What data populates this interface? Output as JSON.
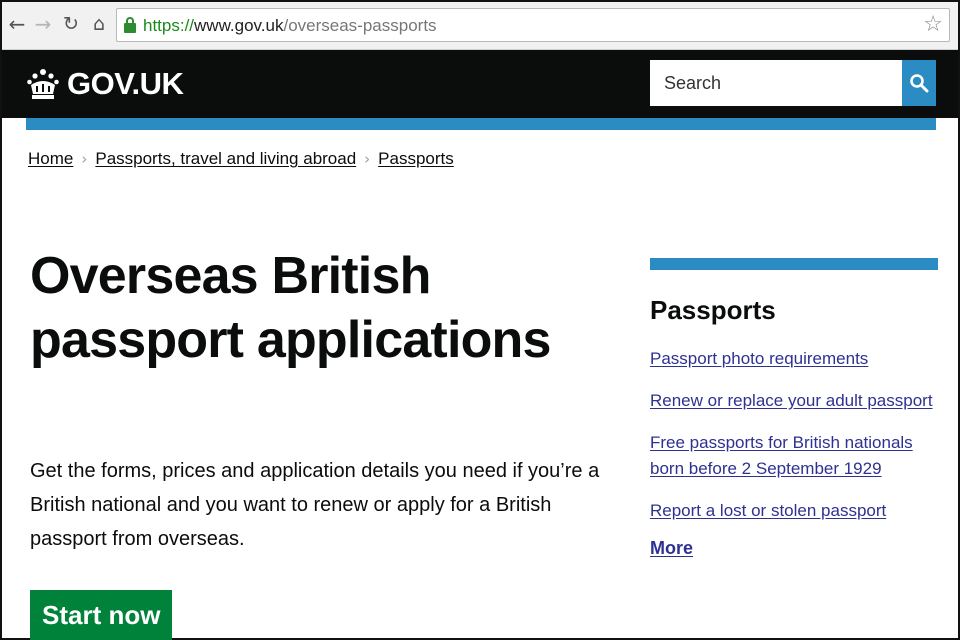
{
  "browser": {
    "url_scheme": "https://",
    "url_host": "www.gov.uk",
    "url_path": "/overseas-passports"
  },
  "header": {
    "logo_text": "GOV.UK",
    "search_placeholder": "Search"
  },
  "breadcrumb": [
    {
      "label": "Home"
    },
    {
      "label": "Passports, travel and living abroad"
    },
    {
      "label": "Passports"
    }
  ],
  "main": {
    "title": "Overseas British passport applications",
    "lead": "Get the forms, prices and application details you need if you’re a British national and you want to renew or apply for a British passport from overseas.",
    "start_label": "Start now"
  },
  "related": {
    "title": "Passports",
    "links": [
      {
        "label": "Passport photo requirements"
      },
      {
        "label": "Renew or replace your adult passport"
      },
      {
        "label": "Free passports for British nationals born before 2 September 1929"
      },
      {
        "label": "Report a lost or stolen passport"
      }
    ],
    "more_label": "More"
  },
  "colors": {
    "header_bg": "#0b0c0c",
    "accent_blue": "#2b8cc4",
    "start_green": "#00823b",
    "link": "#2e3191"
  },
  "icons": {
    "back": "back-arrow-icon",
    "forward": "forward-arrow-icon",
    "reload": "reload-icon",
    "home": "home-icon",
    "lock": "lock-icon",
    "bookmark": "star-icon",
    "logo": "crown-icon",
    "search": "search-icon",
    "separator": "chevron-right-icon"
  }
}
